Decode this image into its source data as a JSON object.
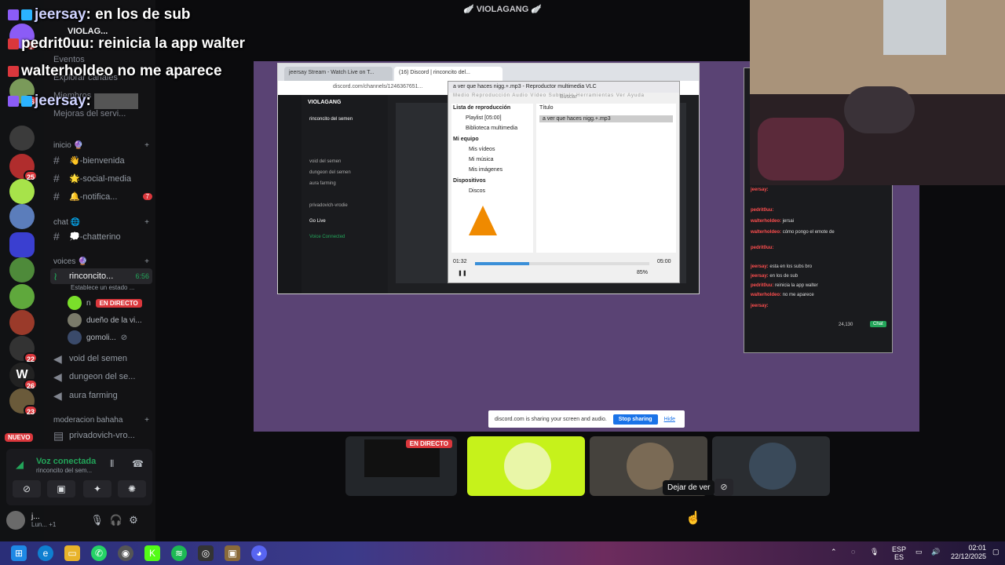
{
  "window_title": "🪽 VIOLAGANG 🪽",
  "stream_chat": [
    {
      "user": "jeersay",
      "text": ": en los de sub"
    },
    {
      "user": "pedrit0uu",
      "text": ": reinicia la app walter"
    },
    {
      "user": "walterholdeo",
      "text": " no me aparece"
    },
    {
      "user": "jeersay",
      "text": ":"
    }
  ],
  "server_rail": {
    "badges": [
      "7",
      "16",
      "25",
      "22",
      "26",
      "23"
    ],
    "new_label": "NUEVO"
  },
  "sidebar": {
    "server_name": "VIOLAG...",
    "top_items": [
      "Eventos",
      "Explorar canales",
      "Miembros",
      "Mejoras del servi..."
    ],
    "categories": {
      "inicio": "inicio 🔮",
      "chat": "chat 🌐",
      "voices": "voices 🔮",
      "moderacion": "moderacion bahaha"
    },
    "text_channels": [
      {
        "label": "👋-bienvenida"
      },
      {
        "label": "🌟-social-media"
      },
      {
        "label": "🔔-notifica...",
        "mention": "7"
      },
      {
        "label": "💭-chatterino"
      }
    ],
    "voice_active": {
      "label": "rinconcito...",
      "time": "6:56",
      "status": "Establece un estado ..."
    },
    "voice_users": [
      {
        "name": "n",
        "live": "EN DIRECTO"
      },
      {
        "name": "dueño de la vi..."
      },
      {
        "name": "gomoli..."
      }
    ],
    "voice_channels": [
      "void del semen",
      "dungeon del se...",
      "aura farming"
    ],
    "mod_channels": [
      "privadovich-vro..."
    ]
  },
  "voice_panel": {
    "title": "Voz conectada",
    "channel": "rinconcito del sem..."
  },
  "user_panel": {
    "name": "j...",
    "status": "Lun... +1"
  },
  "shared_screen": {
    "tabs": [
      "jeersay Stream - Watch Live on T...",
      "(16) Discord | rinconcito del..."
    ],
    "address": "discord.com/channels/1246367651...",
    "inner_server": "VIOLAGANG",
    "inner_channels": [
      "rinconcito del semen",
      "void del semen",
      "dungeon del semen",
      "aura farming",
      "privadovich-vrodie"
    ],
    "inner_go_live": "Go Live",
    "inner_voice": "Voice Connected",
    "vlc": {
      "title": "a ver que haces nigg.+.mp3 - Reproductor multimedia VLC",
      "menu": "Medio  Reproducción  Audio  Vídeo  Subtítulo  Herramientas  Ver  Ayuda",
      "playlist_header": "Lista de reproducción",
      "playlist_item": "Playlist [05:00]",
      "media_library": "Biblioteca multimedia",
      "my_computer": "Mi equipo",
      "my_videos": "Mis vídeos",
      "my_music": "Mi música",
      "my_images": "Mis imágenes",
      "devices": "Dispositivos",
      "discs": "Discos",
      "search": "Buscar",
      "col_title": "Título",
      "track": "a ver que haces nigg.+.mp3",
      "time_current": "01:32",
      "time_total": "05:00",
      "progress": 0.31,
      "volume": "85%"
    },
    "share_banner": {
      "text": "discord.com is sharing your screen and audio.",
      "stop": "Stop sharing",
      "hide": "Hide"
    },
    "side_chat": [
      {
        "user": "jeersay:",
        "text": ""
      },
      {
        "user": "pedrit0uu:",
        "text": ""
      },
      {
        "user": "walterholdeo:",
        "text": "jersai"
      },
      {
        "user": "walterholdeo:",
        "text": "cómo pongo el emote de"
      },
      {
        "user": "pedrit0uu:",
        "text": ""
      },
      {
        "user": "jeersay:",
        "text": "esta en los subs bro"
      },
      {
        "user": "jeersay:",
        "text": "en los de sub"
      },
      {
        "user": "pedrit0uu:",
        "text": "reinicia la app walter"
      },
      {
        "user": "walterholdeo:",
        "text": "no me aparece"
      },
      {
        "user": "jeersay:",
        "text": ""
      }
    ],
    "side_chat_footer": "24,130",
    "side_chat_button": "Chat"
  },
  "tiles": {
    "live_label": "EN DIRECTO",
    "tooltip": "Dejar de ver"
  },
  "taskbar": {
    "lang_top": "ESP",
    "lang_bottom": "ES",
    "time": "02:01",
    "date": "22/12/2025"
  },
  "colors": {
    "stage": "#5a4374",
    "green": "#23a55a",
    "red": "#da373c",
    "tile_yellow": "#c6f21b"
  }
}
